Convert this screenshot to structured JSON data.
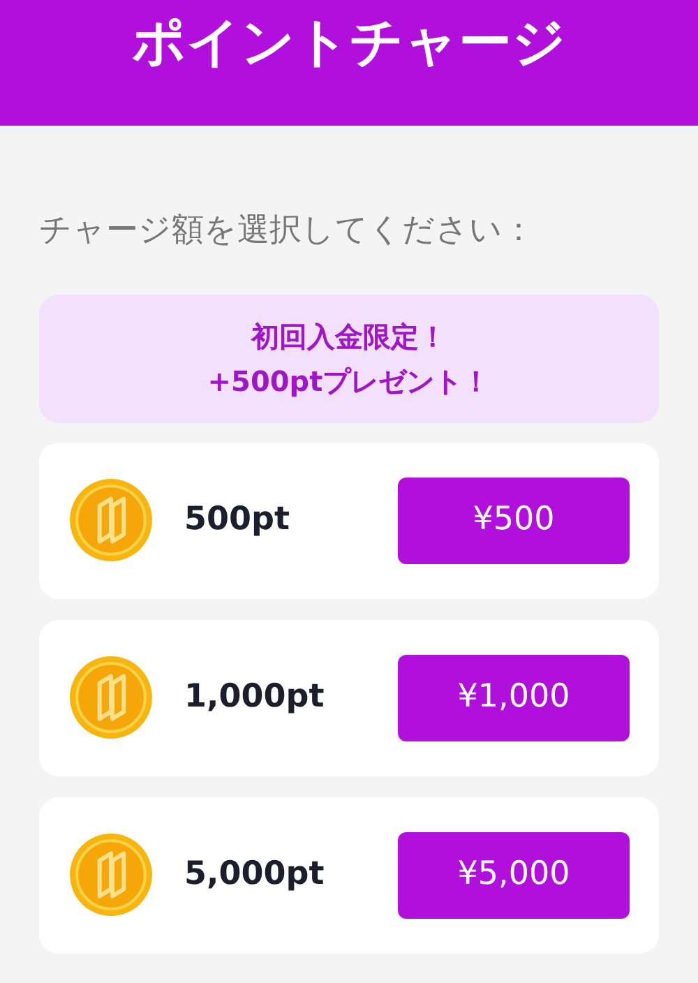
{
  "header": {
    "title": "ポイントチャージ"
  },
  "prompt": "チャージ額を選択してください：",
  "promo": {
    "lines": [
      "初回入金限定！",
      "+500ptプレゼント！"
    ]
  },
  "options": [
    {
      "points": "500pt",
      "price": "¥500"
    },
    {
      "points": "1,000pt",
      "price": "¥1,000"
    },
    {
      "points": "5,000pt",
      "price": "¥5,000"
    }
  ]
}
